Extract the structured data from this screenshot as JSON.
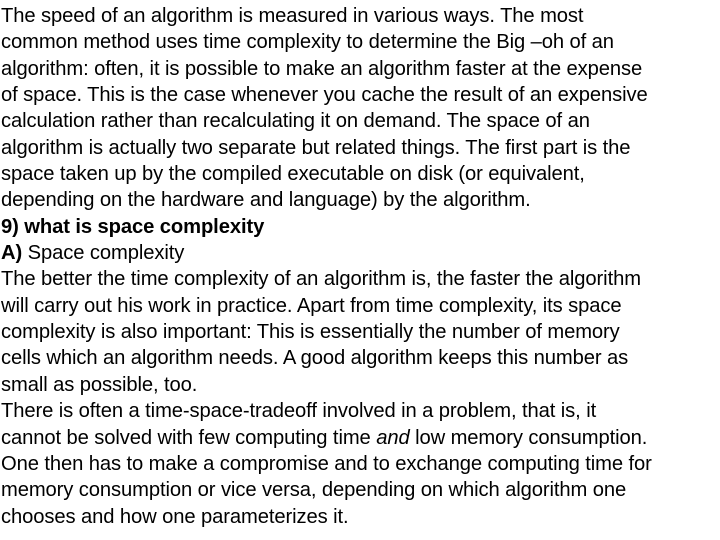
{
  "document": {
    "intro_paragraph": {
      "lines": [
        "The speed of an algorithm is measured in various ways. The most",
        "common method uses time complexity to determine the Big –oh of an",
        "algorithm: often, it is possible to make an algorithm faster at the expense",
        "of space. This is the case whenever you cache the result of an expensive",
        "calculation rather than recalculating it on demand. The space of an",
        "algorithm is actually two separate but related things. The first part is the",
        "space taken up by the compiled executable on disk (or equivalent,",
        "depending on the hardware and language) by the algorithm."
      ]
    },
    "question": {
      "text": "9) what is space complexity"
    },
    "answer": {
      "label": "A)",
      "text": " Space complexity"
    },
    "answer_paragraph": {
      "lines": [
        "The better the time complexity of an algorithm is, the faster the algorithm",
        "will carry out his work in practice. Apart from time complexity, its space",
        "complexity is also important: This is essentially the number of memory",
        "cells which an algorithm needs. A good algorithm keeps this number as",
        "small as possible, too."
      ]
    },
    "tradeoff_paragraph": {
      "line1": "There is often a time-space-tradeoff involved in a problem, that is, it",
      "line2_before": "cannot be solved with few computing time ",
      "line2_emphasis": "and",
      "line2_after": " low memory consumption.",
      "line3": "One then has to make a compromise and to exchange computing time for",
      "line4": "memory consumption or vice versa, depending on which algorithm one",
      "line5": "chooses and how one parameterizes it."
    }
  }
}
